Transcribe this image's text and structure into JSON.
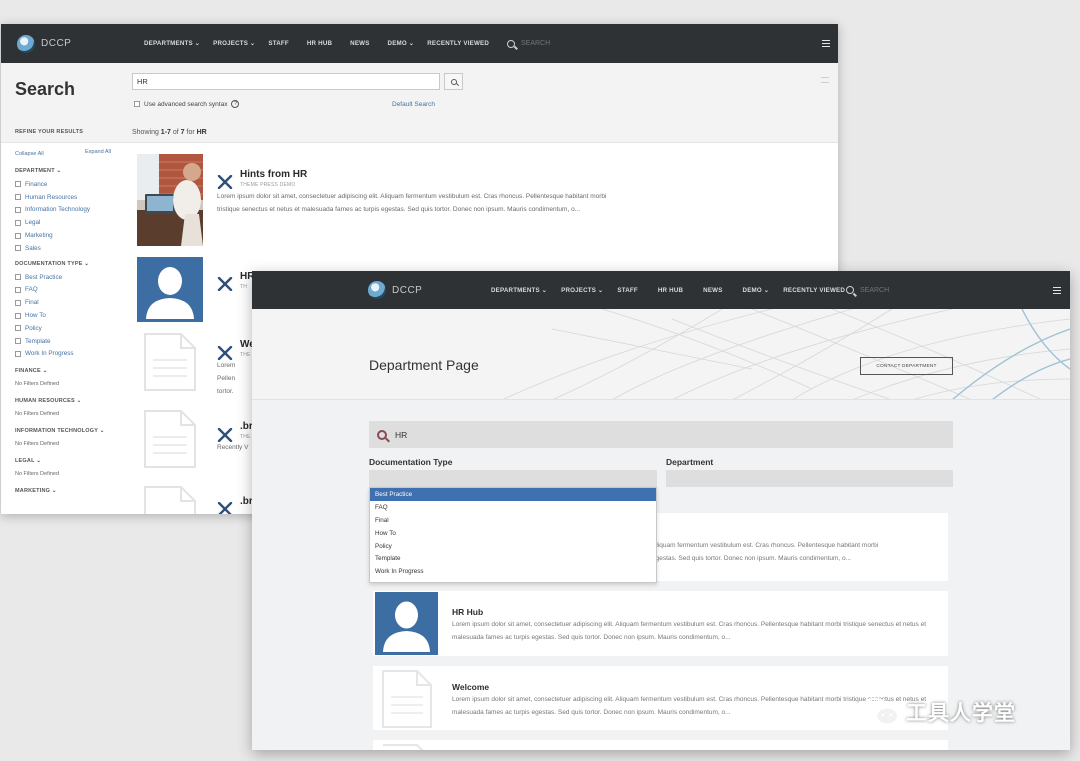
{
  "window1": {
    "nav": {
      "logo_text": "DCCP",
      "menu": [
        "DEPARTMENTS ⌄",
        "PROJECTS ⌄",
        "STAFF",
        "HR HUB",
        "NEWS",
        "DEMO ⌄",
        "RECENTLY VIEWED"
      ],
      "search_placeholder": "SEARCH"
    },
    "search": {
      "title": "Search",
      "query": "HR",
      "advanced_label": "Use advanced search syntax",
      "default_search": "Default Search"
    },
    "sidebar": {
      "refine": "REFINE YOUR RESULTS",
      "collapse_all": "Collapse All",
      "expand_all": "Expand All",
      "department_heading": "DEPARTMENT ⌄",
      "departments": [
        "Finance",
        "Human Resources",
        "Information Technology",
        "Legal",
        "Marketing",
        "Sales"
      ],
      "doc_type_heading": "DOCUMENTATION TYPE ⌄",
      "doc_types": [
        "Best Practice",
        "FAQ",
        "Final",
        "How To",
        "Policy",
        "Template",
        "Work In Progress"
      ],
      "groups": [
        {
          "heading": "FINANCE ⌄",
          "note": "No Filters Defined"
        },
        {
          "heading": "HUMAN RESOURCES ⌄",
          "note": "No Filters Defined"
        },
        {
          "heading": "INFORMATION TECHNOLOGY ⌄",
          "note": "No Filters Defined"
        },
        {
          "heading": "LEGAL ⌄",
          "note": "No Filters Defined"
        },
        {
          "heading": "MARKETING ⌄",
          "note": ""
        }
      ]
    },
    "results": {
      "showing_pre": "Showing ",
      "showing_range": "1-7",
      "showing_mid": " of ",
      "showing_total": "7",
      "showing_for": " for ",
      "showing_query": "HR",
      "items": [
        {
          "title": "Hints from HR",
          "sub": "THEME PRESS DEMO",
          "body": "Lorem ipsum dolor sit amet, consectetuer adipiscing elit. Aliquam fermentum vestibulum est. Cras rhoncus. Pellentesque habitant morbi tristique senectus et netus et malesuada fames ac turpis egestas. Sed quis tortor. Donec non ipsum. Mauris condimentum, o..."
        },
        {
          "title": "HR",
          "sub": "TH",
          "body": ""
        },
        {
          "title": "We",
          "sub": "THE",
          "body": "Lorem\nPellen\ntortor."
        },
        {
          "title": ".br",
          "sub": "THE",
          "body": "Recently V"
        },
        {
          "title": ".br",
          "sub": "",
          "body": ""
        }
      ]
    }
  },
  "window2": {
    "nav": {
      "logo_text": "DCCP",
      "menu": [
        "DEPARTMENTS ⌄",
        "PROJECTS ⌄",
        "STAFF",
        "HR HUB",
        "NEWS",
        "DEMO ⌄",
        "RECENTLY VIEWED"
      ],
      "search_placeholder": "SEARCH"
    },
    "page_title": "Department Page",
    "contact_button": "CONTACT DEPARTMENT",
    "search_query": "HR",
    "filters": {
      "doc_type_label": "Documentation Type",
      "department_label": "Department",
      "options": [
        "Best Practice",
        "FAQ",
        "Final",
        "How To",
        "Policy",
        "Template",
        "Work In Progress"
      ],
      "selected": "Best Practice"
    },
    "cards": [
      {
        "title": "",
        "body": "Aliquam fermentum vestibulum est. Cras rhoncus. Pellentesque habitant morbi\negestas. Sed quis tortor. Donec non ipsum. Mauris condimentum, o..."
      },
      {
        "title": "HR Hub",
        "body": "Lorem ipsum dolor sit amet, consectetuer adipiscing elit. Aliquam fermentum vestibulum est. Cras rhoncus. Pellentesque habitant morbi tristique senectus et netus et malesuada fames ac turpis egestas. Sed quis tortor. Donec non ipsum. Mauris condimentum, o..."
      },
      {
        "title": "Welcome",
        "body": "Lorem ipsum dolor sit amet, consectetuer adipiscing elit. Aliquam fermentum vestibulum est. Cras rhoncus. Pellentesque habitant morbi tristique senectus et netus et malesuada fames ac turpis egestas. Sed quis tortor. Donec non ipsum. Mauris condimentum, o..."
      }
    ]
  },
  "watermark": {
    "text": "工具人学堂",
    "icon": "wechat-icon"
  },
  "colors": {
    "nav": "#2e3235",
    "link": "#4672a3",
    "avatar": "#3d6ea3",
    "selected": "#3f70b0",
    "search_icon": "#874b55"
  }
}
